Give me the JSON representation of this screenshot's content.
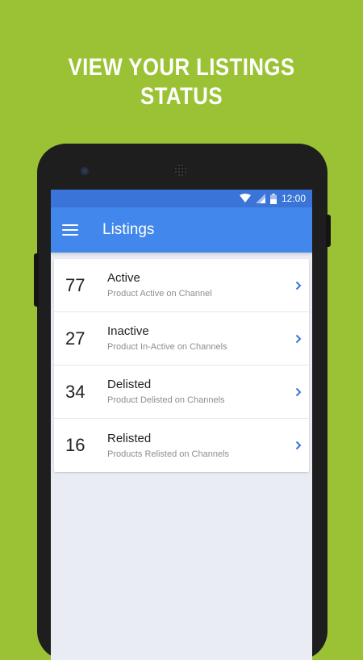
{
  "promo": {
    "title": "VIEW YOUR LISTINGS STATUS"
  },
  "status_bar": {
    "time": "12:00",
    "icons": [
      "wifi-icon",
      "signal-icon",
      "battery-icon"
    ]
  },
  "app_bar": {
    "title": "Listings",
    "menu_icon": "hamburger-menu-icon"
  },
  "listings": [
    {
      "count": "77",
      "title": "Active",
      "subtitle": "Product Active on Channel"
    },
    {
      "count": "27",
      "title": "Inactive",
      "subtitle": "Product In-Active on Channels"
    },
    {
      "count": "34",
      "title": "Delisted",
      "subtitle": "Product Delisted on Channels"
    },
    {
      "count": "16",
      "title": "Relisted",
      "subtitle": "Products Relisted on Channels"
    }
  ],
  "colors": {
    "background": "#9bc234",
    "status_bar": "#3a74d8",
    "app_bar": "#4287ec",
    "chevron": "#3a74d8",
    "screen_bg": "#e9edf3"
  }
}
